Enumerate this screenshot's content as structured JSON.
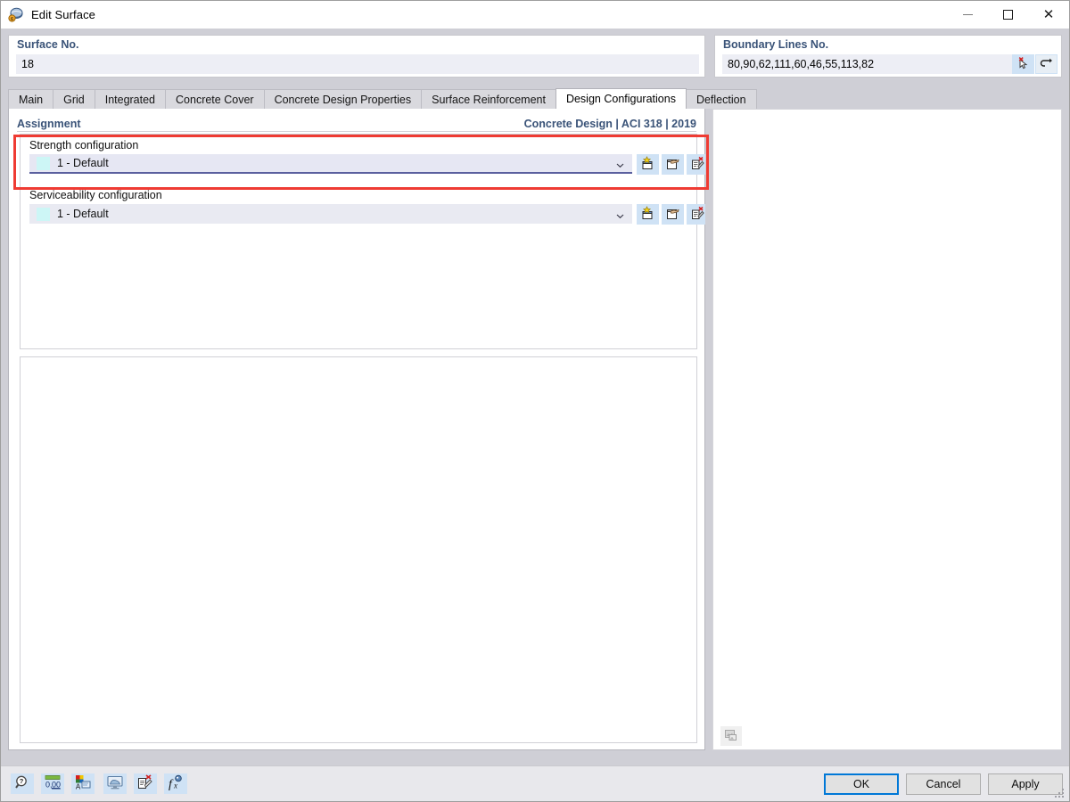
{
  "window": {
    "title": "Edit Surface",
    "icon": "surface-icon",
    "controls": {
      "minimize": "minimize-icon",
      "maximize": "maximize-icon",
      "close": "close-icon"
    }
  },
  "surface_field": {
    "label": "Surface No.",
    "value": "18"
  },
  "boundary_field": {
    "label": "Boundary Lines No.",
    "value": "80,90,62,111,60,46,55,113,82",
    "pick_button": "pick-from-view-icon",
    "undo_button": "undo-icon"
  },
  "tabs": [
    {
      "label": "Main",
      "active": false
    },
    {
      "label": "Grid",
      "active": false
    },
    {
      "label": "Integrated",
      "active": false
    },
    {
      "label": "Concrete Cover",
      "active": false
    },
    {
      "label": "Concrete Design Properties",
      "active": false
    },
    {
      "label": "Surface Reinforcement",
      "active": false
    },
    {
      "label": "Design Configurations",
      "active": true
    },
    {
      "label": "Deflection",
      "active": false
    }
  ],
  "assignment": {
    "title": "Assignment",
    "standard": "Concrete Design | ACI 318 | 2019"
  },
  "configurations": [
    {
      "label": "Strength configuration",
      "value": "1 - Default",
      "swatch_color": "#cdf6f6",
      "focused": true,
      "buttons": [
        "new-configuration-icon",
        "edit-configuration-icon",
        "delete-configuration-icon"
      ]
    },
    {
      "label": "Serviceability configuration",
      "value": "1 - Default",
      "swatch_color": "#cdf6f6",
      "focused": false,
      "buttons": [
        "new-configuration-icon",
        "edit-configuration-icon",
        "delete-configuration-icon"
      ]
    }
  ],
  "highlight": {
    "color": "#ef3b33",
    "target": "strength-configuration-row"
  },
  "right_panel": {
    "image_button": "render-image-icon"
  },
  "bottom_toolbar": [
    {
      "name": "help-search-icon"
    },
    {
      "name": "number-format-icon",
      "text": "0.00"
    },
    {
      "name": "display-properties-icon"
    },
    {
      "name": "visibility-icon"
    },
    {
      "name": "delete-icon"
    },
    {
      "name": "formula-icon",
      "text": "f"
    }
  ],
  "dialog_buttons": [
    {
      "label": "OK",
      "primary": true
    },
    {
      "label": "Cancel",
      "primary": false
    },
    {
      "label": "Apply",
      "primary": false
    }
  ]
}
